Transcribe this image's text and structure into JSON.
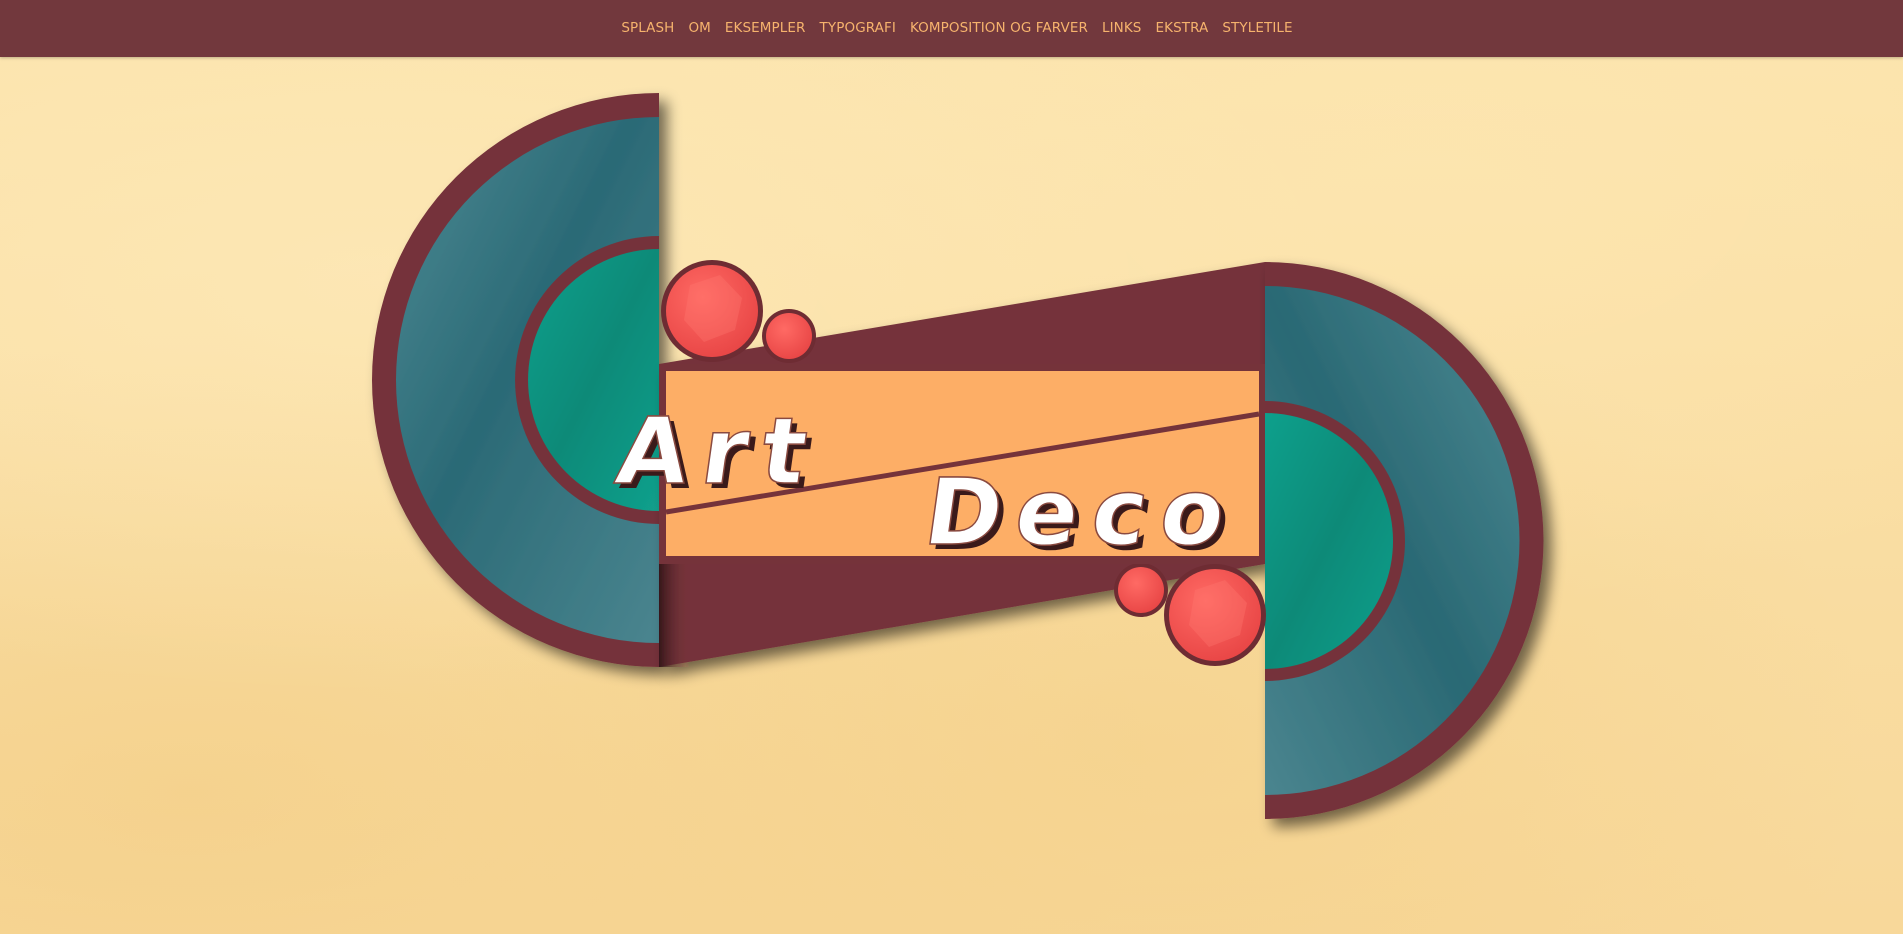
{
  "nav": {
    "items": [
      {
        "label": "SPLASH"
      },
      {
        "label": "OM"
      },
      {
        "label": "EKSEMPLER"
      },
      {
        "label": "TYPOGRAFI"
      },
      {
        "label": "KOMPOSITION OG FARVER"
      },
      {
        "label": "LINKS"
      },
      {
        "label": "EKSTRA"
      },
      {
        "label": "STYLETILE"
      }
    ]
  },
  "logo": {
    "word_top": "Art",
    "word_bottom": "Deco"
  },
  "colors": {
    "nav_background": "#72383d",
    "nav_text": "#f6b36d",
    "page_background": "#f9dea0",
    "maroon": "#75333a",
    "teal_outer": "#3f7883",
    "teal_inner": "#0e9b87",
    "banner_orange": "#fdae66",
    "circle_red": "#f24e4e"
  }
}
